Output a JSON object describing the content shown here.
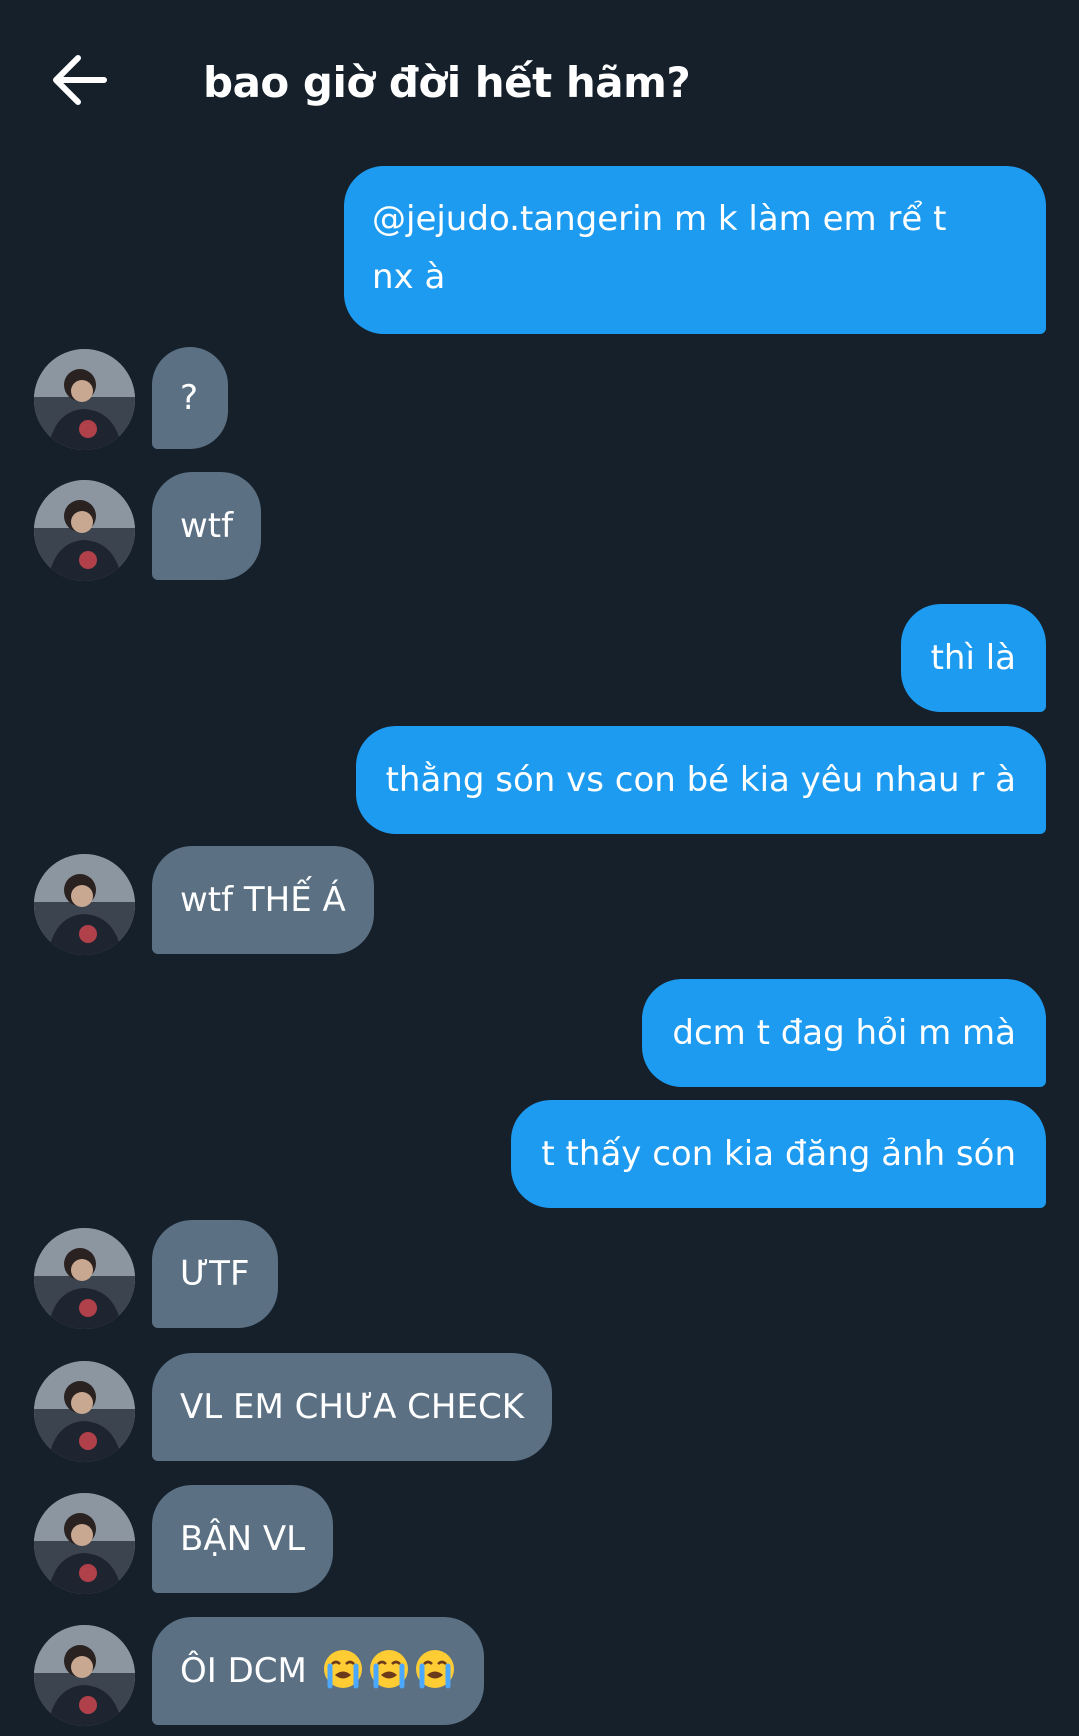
{
  "header": {
    "title": "bao giờ đời hết hãm?",
    "back_icon": "arrow-left-icon"
  },
  "colors": {
    "background": "#15202b",
    "outgoing_bubble": "#1d9bf0",
    "incoming_bubble": "#5b7083"
  },
  "messages": [
    {
      "direction": "out",
      "text": "@jejudo.tangerin m k làm em rể t nx à"
    },
    {
      "direction": "in",
      "text": "?"
    },
    {
      "direction": "in",
      "text": "wtf"
    },
    {
      "direction": "out",
      "text": "thì là"
    },
    {
      "direction": "out",
      "text": "thằng són vs con bé kia yêu nhau r à"
    },
    {
      "direction": "in",
      "text": "wtf THẾ Á"
    },
    {
      "direction": "out",
      "text": "dcm t đag hỏi m mà"
    },
    {
      "direction": "out",
      "text": "t thấy con kia đăng ảnh són"
    },
    {
      "direction": "in",
      "text": "ƯTF"
    },
    {
      "direction": "in",
      "text": "VL EM CHƯA CHECK"
    },
    {
      "direction": "in",
      "text": "BẬN VL"
    },
    {
      "direction": "in",
      "text": "ÔI DCM",
      "emojis": [
        "loudly-crying-face-emoji",
        "loudly-crying-face-emoji",
        "loudly-crying-face-emoji"
      ]
    }
  ]
}
